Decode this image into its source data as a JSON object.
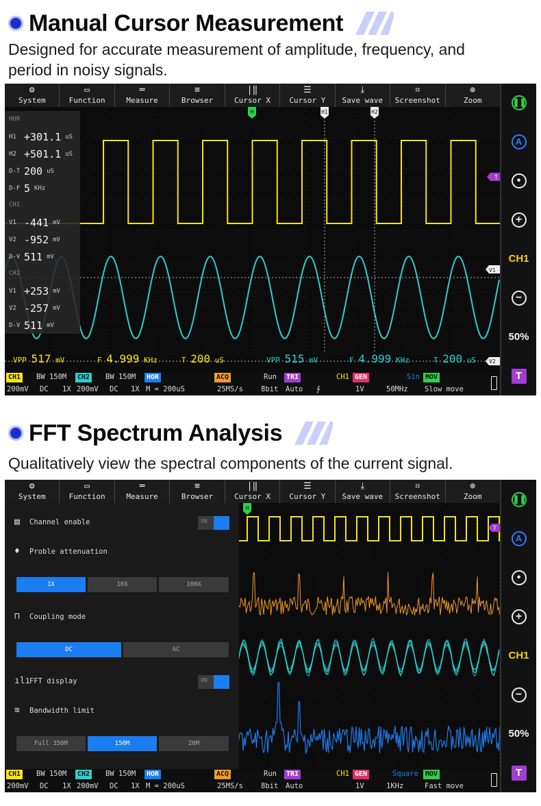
{
  "section1": {
    "title": "Manual Cursor Measurement",
    "description_line1": "Designed for accurate measurement of amplitude, frequency, and",
    "description_line2": "period in noisy signals."
  },
  "section2": {
    "title": "FFT Spectrum Analysis",
    "description": "Qualitatively view the spectral components of the current signal."
  },
  "toolbar": [
    {
      "icon": "gear-icon",
      "glyph": "⚙",
      "label": "System"
    },
    {
      "icon": "monitor-icon",
      "glyph": "▭",
      "label": "Function"
    },
    {
      "icon": "ruler-icon",
      "glyph": "═",
      "label": "Measure"
    },
    {
      "icon": "database-icon",
      "glyph": "≡",
      "label": "Browser"
    },
    {
      "icon": "cursor-x-icon",
      "glyph": "|‖",
      "label": "Cursor X"
    },
    {
      "icon": "cursor-y-icon",
      "glyph": "☰",
      "label": "Cursor Y"
    },
    {
      "icon": "wave-icon",
      "glyph": "⤓",
      "label": "Save wave"
    },
    {
      "icon": "crop-icon",
      "glyph": "⌗",
      "label": "Screenshot"
    },
    {
      "icon": "zoom-icon",
      "glyph": "⊕",
      "label": "Zoom"
    }
  ],
  "sidebar": {
    "ch": "CH1",
    "pct": "50%",
    "trig": "T",
    "auto": "A"
  },
  "cursor_panel": {
    "hor_head": "HOR",
    "h1": {
      "k": "H1",
      "v": "+301.1",
      "u": "uS"
    },
    "h2": {
      "k": "H2",
      "v": "+501.1",
      "u": "uS"
    },
    "dt": {
      "k": "D-T",
      "v": "200",
      "u": "uS"
    },
    "df": {
      "k": "D-F",
      "v": "5",
      "u": "KHz"
    },
    "ch1_head": "CH1",
    "v1": {
      "k": "V1",
      "v": "-441",
      "u": "mV"
    },
    "v2": {
      "k": "V2",
      "v": "-952",
      "u": "mV"
    },
    "dv": {
      "k": "D-V",
      "v": "511",
      "u": "mV"
    },
    "ch2_head": "CH2",
    "v1b": {
      "k": "V1",
      "v": "+253",
      "u": "mV"
    },
    "v2b": {
      "k": "V2",
      "v": "-257",
      "u": "mV"
    },
    "dvb": {
      "k": "D-V",
      "v": "511",
      "u": "mV"
    }
  },
  "markers": {
    "h": "H",
    "h1": "H1",
    "h2": "H2",
    "t": "T",
    "v1": "V1",
    "v2": "V2"
  },
  "measure": {
    "vpp1_k": "VPP",
    "vpp1_v": "517",
    "vpp1_u": "mV",
    "f1_k": "F",
    "f1_v": "4.999",
    "f1_u": "KHz",
    "t1_k": "T",
    "t1_v": "200",
    "t1_u": "uS",
    "vpp2_k": "VPP",
    "vpp2_v": "515",
    "vpp2_u": "mV",
    "f2_k": "F",
    "f2_v": "4.999",
    "f2_u": "KHz",
    "t2_k": "T",
    "t2_v": "200",
    "t2_u": "uS"
  },
  "status1": {
    "ch1": "CH1",
    "bw1": "BW 150M",
    "ch1_v": "200mV",
    "ch1_c": "DC",
    "ch1_x": "1X",
    "ch2": "CH2",
    "bw2": "BW 150M",
    "ch2_v": "200mV",
    "ch2_c": "DC",
    "ch2_x": "1X",
    "hor": "HOR",
    "hor_m": "M = 200uS",
    "acq": "ACQ",
    "acq_run": "Run",
    "acq_rate": "25MS/s",
    "acq_bit": "8bit",
    "tri": "TRI",
    "tri_mode": "Auto",
    "tri_edge": "∱",
    "gen_ch": "CH1",
    "gen": "GEN",
    "gen_wave": "Sin",
    "gen_amp": "1V",
    "gen_f": "50MHz",
    "mov": "MOV",
    "mov_v": "Slow move"
  },
  "status2": {
    "ch1": "CH1",
    "bw1": "BW 150M",
    "ch1_v": "200mV",
    "ch1_c": "DC",
    "ch1_x": "1X",
    "ch2": "CH2",
    "bw2": "BW 150M",
    "ch2_v": "200mV",
    "ch2_c": "DC",
    "ch2_x": "1X",
    "hor": "HOR",
    "hor_m": "M = 200uS",
    "acq": "ACQ",
    "acq_run": "Run",
    "acq_rate": "25MS/s",
    "acq_bit": "8bit",
    "tri": "TRI",
    "tri_mode": "Auto",
    "gen_ch": "CH1",
    "gen": "GEN",
    "gen_wave": "Square",
    "gen_amp": "1V",
    "gen_f": "1KHz",
    "mov": "MOV",
    "mov_v": "Fast move"
  },
  "fft_panel": {
    "channel_enable": "Channel enable",
    "probe_att": "Proble attenuation",
    "att_options": [
      "1X",
      "10X",
      "100X"
    ],
    "coupling": "Coupling mode",
    "coupling_options": [
      "DC",
      "AC"
    ],
    "fft_display": "FFT display",
    "bandwidth": "Bandwidth limit",
    "bw_options": [
      "Full 350M",
      "150M",
      "20M"
    ],
    "on": "ON"
  },
  "colors": {
    "ch1": "#f5e616",
    "ch2": "#2ad0cf",
    "fft": "#1e7ef0",
    "math": "#f39a2a",
    "accent": "#1a7df0",
    "trigger": "#a33dd1"
  }
}
